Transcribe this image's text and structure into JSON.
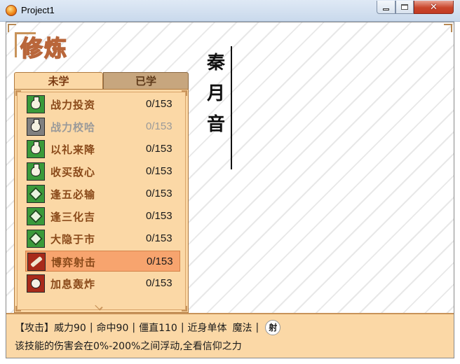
{
  "window": {
    "title": "Project1",
    "icon": "app-orb-icon"
  },
  "page": {
    "heading": "修炼"
  },
  "tabs": [
    {
      "label": "未学",
      "active": true
    },
    {
      "label": "已学",
      "active": false
    }
  ],
  "skills": [
    {
      "name": "战力投资",
      "count": "0/153",
      "icon": "bag-icon",
      "icon_color": "#3a9a3a",
      "disabled": false,
      "selected": false
    },
    {
      "name": "战力校哈",
      "count": "0/153",
      "icon": "bag-icon",
      "icon_color": "#808080",
      "disabled": true,
      "selected": false
    },
    {
      "name": "以礼来降",
      "count": "0/153",
      "icon": "bag-icon",
      "icon_color": "#3a9a3a",
      "disabled": false,
      "selected": false
    },
    {
      "name": "收买敌心",
      "count": "0/153",
      "icon": "bag-icon",
      "icon_color": "#3a9a3a",
      "disabled": false,
      "selected": false
    },
    {
      "name": "逢五必输",
      "count": "0/153",
      "icon": "card-icon",
      "icon_color": "#3a9a3a",
      "disabled": false,
      "selected": false
    },
    {
      "name": "逢三化吉",
      "count": "0/153",
      "icon": "card-icon",
      "icon_color": "#3a9a3a",
      "disabled": false,
      "selected": false
    },
    {
      "name": "大隐于市",
      "count": "0/153",
      "icon": "card-icon",
      "icon_color": "#3a9a3a",
      "disabled": false,
      "selected": false
    },
    {
      "name": "博弈射击",
      "count": "0/153",
      "icon": "gun-icon",
      "icon_color": "#a82a1a",
      "disabled": false,
      "selected": true
    },
    {
      "name": "加息轰炸",
      "count": "0/153",
      "icon": "bomb-icon",
      "icon_color": "#a82a1a",
      "disabled": false,
      "selected": false
    }
  ],
  "character": {
    "name_chars": [
      "秦",
      "月",
      "音"
    ]
  },
  "info": {
    "type": "【攻击】",
    "power": "威力90",
    "accuracy": "命中90",
    "stiffness": "僵直110",
    "range": "近身单体",
    "category": "魔法",
    "element_icon_label": "射",
    "description": "该技能的伤害会在0%-200%之间浮动,全看信仰之力"
  }
}
